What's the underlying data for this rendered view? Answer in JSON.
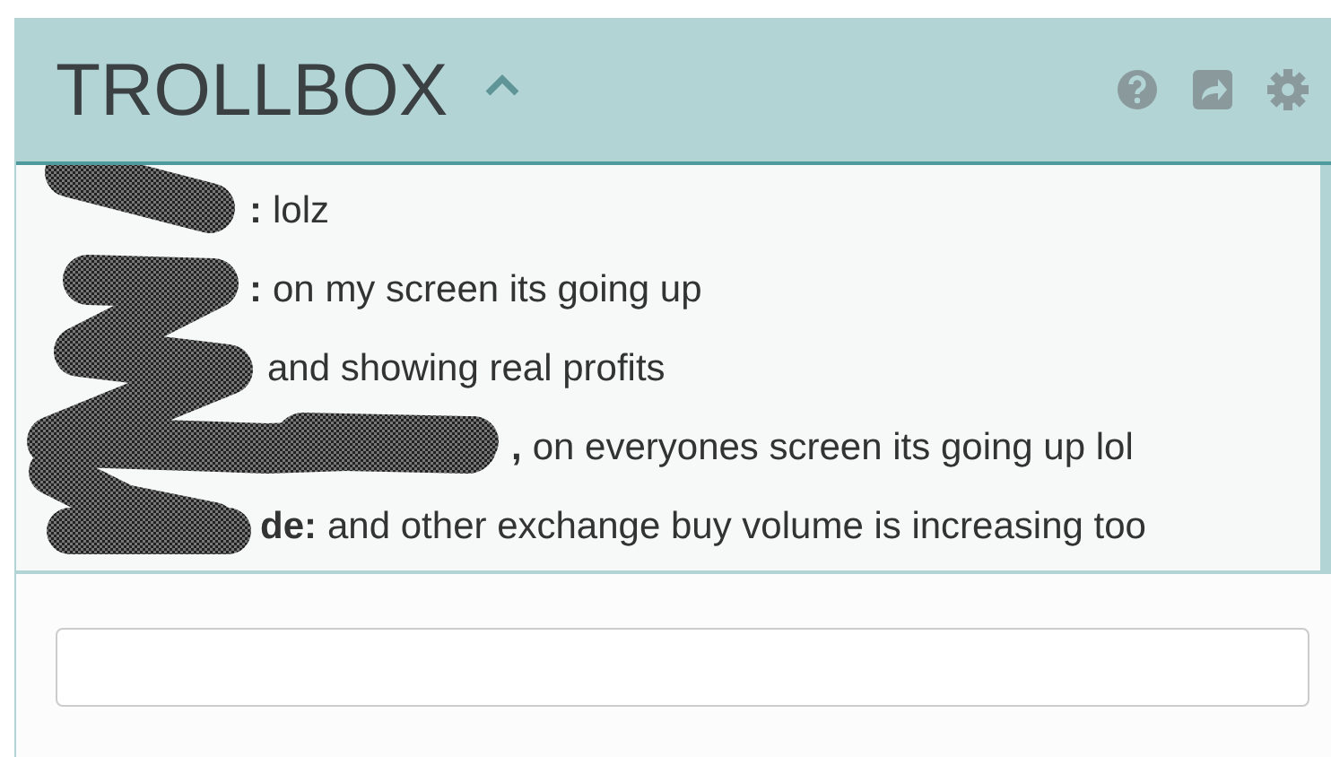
{
  "header": {
    "title": "TROLLBOX",
    "expanded": true
  },
  "messages": [
    {
      "name": ":",
      "text": "lolz"
    },
    {
      "name": ":",
      "text": "on my screen its going up"
    },
    {
      "text": "and showing real profits"
    },
    {
      "name": ",",
      "text": "on everyones screen its going up lol"
    },
    {
      "name": "de:",
      "text": "and other exchange buy volume is increasing too"
    }
  ]
}
